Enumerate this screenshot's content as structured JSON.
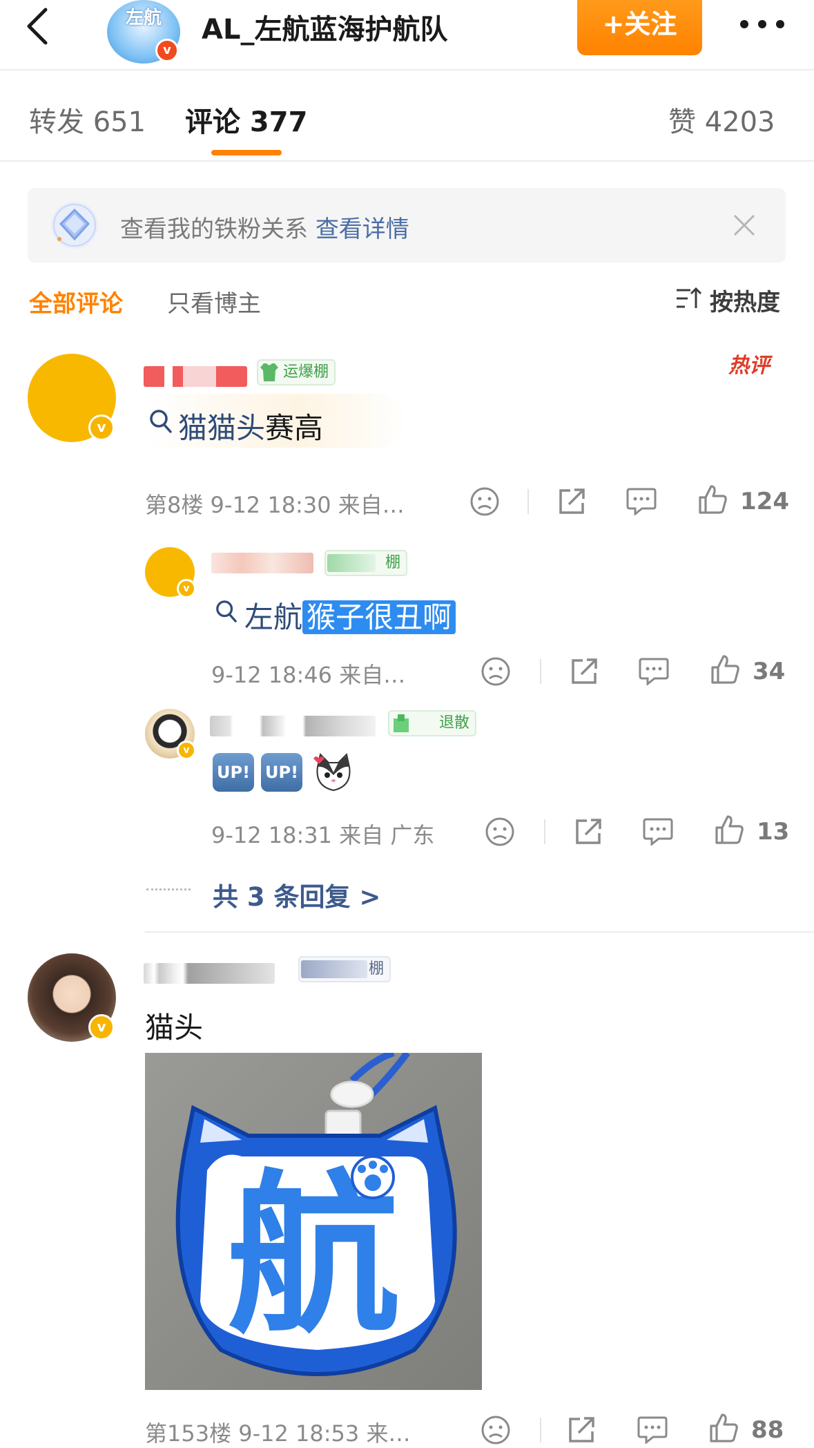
{
  "header": {
    "avatar_text": "左航",
    "title": "AL_左航蓝海护航队",
    "follow_label": "+关注"
  },
  "tabs": {
    "reposts": "转发 651",
    "comments": "评论 377",
    "likes": "赞 4203"
  },
  "fan_banner": {
    "text": "查看我的铁粉关系",
    "link": "查看详情"
  },
  "filters": {
    "all": "全部评论",
    "owner_only": "只看博主",
    "sort": "按热度"
  },
  "comments": [
    {
      "tag": "运爆棚",
      "search_term": "猫猫头",
      "text_rest": "赛高",
      "hot_badge": "热评",
      "meta": "第8楼  9-12 18:30  来自…",
      "likes": "124"
    },
    {
      "tag": "棚",
      "search_term": "左航",
      "highlighted": "猴子很丑啊",
      "meta": "9-12 18:46  来自…",
      "likes": "34"
    },
    {
      "tag": "退散",
      "emoji_1": "UP!",
      "emoji_2": "UP!",
      "meta": "9-12 18:31  来自 广东",
      "likes": "13"
    },
    {
      "tag": "棚",
      "text": "猫头",
      "photo_char": "航",
      "meta": "第153楼  9-12 18:53  来…",
      "likes": "88"
    }
  ],
  "replies_link": "共 3 条回复 >",
  "colors": {
    "accent_orange": "#ff8200",
    "link_blue": "#4a6ea5",
    "verified_gold": "#f7b500",
    "highlight_blue": "#2e8cf0"
  }
}
